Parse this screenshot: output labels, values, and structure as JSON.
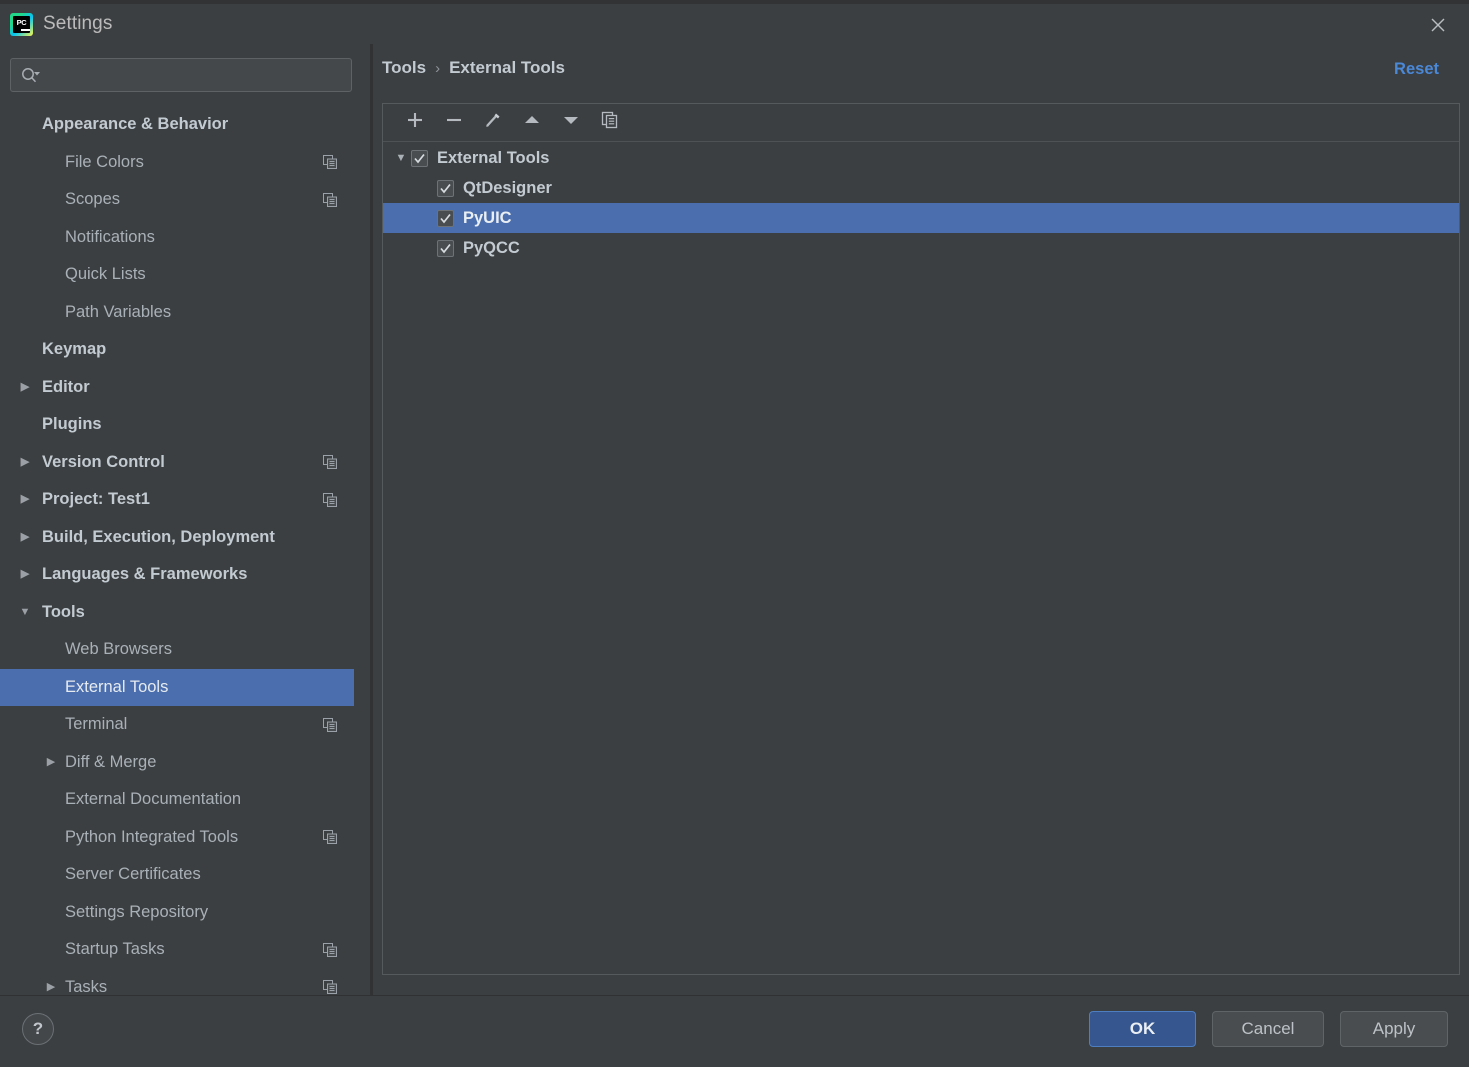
{
  "window": {
    "title": "Settings",
    "app_icon": "pycharm-logo-icon",
    "app_icon_text": "PC",
    "close_icon": "close-icon"
  },
  "colors": {
    "background": "#3c3f41",
    "selection_blue": "#4b6eaf",
    "accent_link": "#4a88d8",
    "default_button": "#36568f",
    "text_primary": "#c3cbd2",
    "text_secondary": "#a9b1b8"
  },
  "search": {
    "value": "",
    "placeholder": "",
    "icon": "search-icon",
    "dropdown_icon": "chevron-down-icon"
  },
  "sidebar": {
    "items": [
      {
        "label": "Appearance & Behavior",
        "level": 0,
        "bold": true,
        "arrow": "",
        "copy": false,
        "selected": false
      },
      {
        "label": "File Colors",
        "level": 1,
        "bold": false,
        "arrow": "",
        "copy": true,
        "selected": false
      },
      {
        "label": "Scopes",
        "level": 1,
        "bold": false,
        "arrow": "",
        "copy": true,
        "selected": false
      },
      {
        "label": "Notifications",
        "level": 1,
        "bold": false,
        "arrow": "",
        "copy": false,
        "selected": false
      },
      {
        "label": "Quick Lists",
        "level": 1,
        "bold": false,
        "arrow": "",
        "copy": false,
        "selected": false
      },
      {
        "label": "Path Variables",
        "level": 1,
        "bold": false,
        "arrow": "",
        "copy": false,
        "selected": false
      },
      {
        "label": "Keymap",
        "level": 0,
        "bold": true,
        "arrow": "",
        "copy": false,
        "selected": false
      },
      {
        "label": "Editor",
        "level": 0,
        "bold": true,
        "arrow": "collapsed",
        "copy": false,
        "selected": false
      },
      {
        "label": "Plugins",
        "level": 0,
        "bold": true,
        "arrow": "",
        "copy": false,
        "selected": false
      },
      {
        "label": "Version Control",
        "level": 0,
        "bold": true,
        "arrow": "collapsed",
        "copy": true,
        "selected": false
      },
      {
        "label": "Project: Test1",
        "level": 0,
        "bold": true,
        "arrow": "collapsed",
        "copy": true,
        "selected": false
      },
      {
        "label": "Build, Execution, Deployment",
        "level": 0,
        "bold": true,
        "arrow": "collapsed",
        "copy": false,
        "selected": false
      },
      {
        "label": "Languages & Frameworks",
        "level": 0,
        "bold": true,
        "arrow": "collapsed",
        "copy": false,
        "selected": false
      },
      {
        "label": "Tools",
        "level": 0,
        "bold": true,
        "arrow": "expanded",
        "copy": false,
        "selected": false
      },
      {
        "label": "Web Browsers",
        "level": 1,
        "bold": false,
        "arrow": "",
        "copy": false,
        "selected": false
      },
      {
        "label": "External Tools",
        "level": 1,
        "bold": false,
        "arrow": "",
        "copy": false,
        "selected": true
      },
      {
        "label": "Terminal",
        "level": 1,
        "bold": false,
        "arrow": "",
        "copy": true,
        "selected": false
      },
      {
        "label": "Diff & Merge",
        "level": 1,
        "bold": false,
        "arrow": "collapsed",
        "copy": false,
        "selected": false
      },
      {
        "label": "External Documentation",
        "level": 1,
        "bold": false,
        "arrow": "",
        "copy": false,
        "selected": false
      },
      {
        "label": "Python Integrated Tools",
        "level": 1,
        "bold": false,
        "arrow": "",
        "copy": true,
        "selected": false
      },
      {
        "label": "Server Certificates",
        "level": 1,
        "bold": false,
        "arrow": "",
        "copy": false,
        "selected": false
      },
      {
        "label": "Settings Repository",
        "level": 1,
        "bold": false,
        "arrow": "",
        "copy": false,
        "selected": false
      },
      {
        "label": "Startup Tasks",
        "level": 1,
        "bold": false,
        "arrow": "",
        "copy": true,
        "selected": false
      },
      {
        "label": "Tasks",
        "level": 1,
        "bold": false,
        "arrow": "collapsed",
        "copy": true,
        "selected": false
      }
    ]
  },
  "main": {
    "breadcrumb": {
      "parent": "Tools",
      "separator": "›",
      "current": "External Tools"
    },
    "reset_label": "Reset",
    "toolbar": [
      {
        "name": "add-button",
        "icon": "plus-icon"
      },
      {
        "name": "remove-button",
        "icon": "minus-icon"
      },
      {
        "name": "edit-button",
        "icon": "pencil-icon"
      },
      {
        "name": "move-up-button",
        "icon": "arrow-up-icon"
      },
      {
        "name": "move-down-button",
        "icon": "arrow-down-icon"
      },
      {
        "name": "copy-button",
        "icon": "copy-icon"
      }
    ],
    "tree": [
      {
        "label": "External Tools",
        "level": 0,
        "checked": true,
        "arrow": "expanded",
        "selected": false
      },
      {
        "label": "QtDesigner",
        "level": 1,
        "checked": true,
        "arrow": "",
        "selected": false
      },
      {
        "label": "PyUIC",
        "level": 1,
        "checked": true,
        "arrow": "",
        "selected": true
      },
      {
        "label": "PyQCC",
        "level": 1,
        "checked": true,
        "arrow": "",
        "selected": false
      }
    ]
  },
  "footer": {
    "help_label": "?",
    "ok_label": "OK",
    "cancel_label": "Cancel",
    "apply_label": "Apply"
  }
}
